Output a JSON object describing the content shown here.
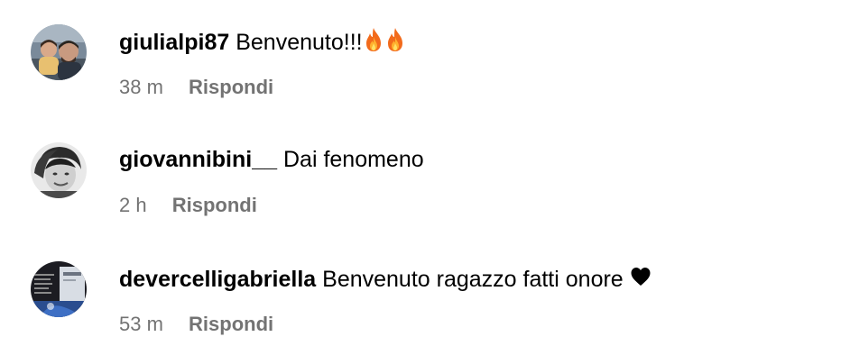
{
  "comments": [
    {
      "username": "giulialpi87",
      "text": "Benvenuto!!!",
      "emojis": [
        "fire-emoji",
        "fire-emoji"
      ],
      "time": "38 m",
      "reply_label": "Rispondi"
    },
    {
      "username": "giovannibini__",
      "text": "Dai fenomeno",
      "time": "2 h",
      "reply_label": "Rispondi"
    },
    {
      "username": "devercelligabriella",
      "text": "Benvenuto ragazzo fatti onore",
      "emojis": [
        "black-heart-emoji"
      ],
      "time": "53 m",
      "reply_label": "Rispondi"
    }
  ],
  "colors": {
    "meta_text": "#737373",
    "primary_text": "#000000",
    "background": "#ffffff"
  }
}
